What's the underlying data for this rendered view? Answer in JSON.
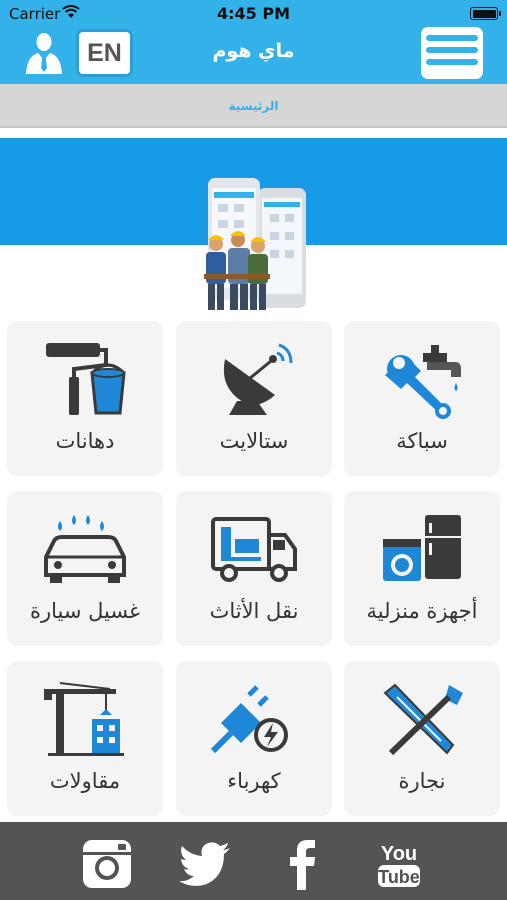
{
  "status_bar": {
    "carrier": "Carrier",
    "time": "4:45 PM"
  },
  "header": {
    "lang_button": "EN",
    "title": "ماي هوم",
    "accent_color": "#33b2ea"
  },
  "breadcrumb": {
    "home": "الرئيسية"
  },
  "services": [
    {
      "label": "سباكة",
      "icon": "plumbing-icon"
    },
    {
      "label": "ستالايت",
      "icon": "satellite-dish-icon"
    },
    {
      "label": "دهانات",
      "icon": "paint-roller-icon"
    },
    {
      "label": "أجهزة منزلية",
      "icon": "home-appliances-icon"
    },
    {
      "label": "نقل الأثاث",
      "icon": "moving-truck-icon"
    },
    {
      "label": "غسيل سيارة",
      "icon": "car-wash-icon"
    },
    {
      "label": "نجارة",
      "icon": "carpentry-tools-icon"
    },
    {
      "label": "كهرباء",
      "icon": "electric-plug-icon"
    },
    {
      "label": "مقاولات",
      "icon": "construction-crane-icon"
    }
  ],
  "footer": {
    "social": [
      "instagram-icon",
      "twitter-icon",
      "facebook-icon",
      "youtube-icon"
    ]
  }
}
